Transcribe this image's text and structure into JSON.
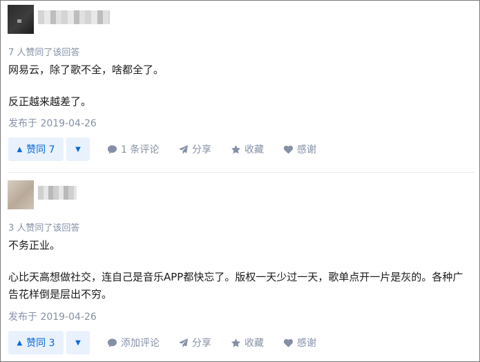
{
  "answers": [
    {
      "agree_text": "7 人赞同了该回答",
      "paragraphs": [
        "网易云，除了歌不全，啥都全了。",
        "反正越来越差了。"
      ],
      "date": "发布于 2019-04-26",
      "vote_up_label": "赞同 7",
      "comment_label": "1 条评论",
      "share_label": "分享",
      "favorite_label": "收藏",
      "thanks_label": "感谢"
    },
    {
      "agree_text": "3 人赞同了该回答",
      "paragraphs": [
        "不务正业。",
        "心比天高想做社交，连自己是音乐APP都快忘了。版权一天少过一天，歌单点开一片是灰的。各种广告花样倒是层出不穷。"
      ],
      "date": "发布于 2019-04-26",
      "vote_up_label": "赞同 3",
      "comment_label": "添加评论",
      "share_label": "分享",
      "favorite_label": "收藏",
      "thanks_label": "感谢"
    }
  ],
  "icons": {
    "vote_up": "triangle-up-icon",
    "vote_down": "triangle-down-icon",
    "comment": "comment-bubble-icon",
    "share": "paper-plane-icon",
    "favorite": "star-icon",
    "thanks": "heart-icon"
  },
  "colors": {
    "accent": "#0a69d8",
    "accent_bg": "#e8f1fc",
    "meta": "#8590a6"
  }
}
